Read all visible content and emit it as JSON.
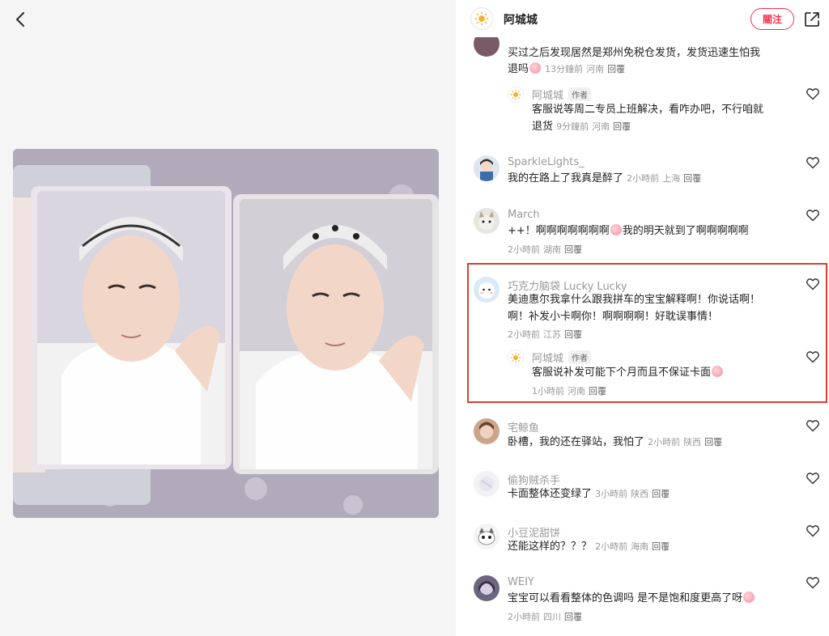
{
  "header": {
    "name": "阿城城",
    "follow_label": "關注"
  },
  "comments": [
    {
      "text_lines": [
        "买过之后发现居然是郑州免税仓发货，发货迅速生怕我",
        "退吗"
      ],
      "time": "13分鐘前",
      "location": "河南",
      "reply": "回覆",
      "reply_item": {
        "name": "阿城城",
        "tag": "作者",
        "text_lines": [
          "客服说等周二专员上班解决，看咋办吧，不行咱就",
          "退货"
        ],
        "time": "9分鐘前",
        "location": "河南",
        "reply": "回覆"
      }
    },
    {
      "name": "SparkleLights_",
      "text": "我的在路上了我真是醉了",
      "time": "2小時前",
      "location": "上海",
      "reply": "回覆"
    },
    {
      "name": "March",
      "text": "++！啊啊啊啊啊啊啊",
      "text_tail": "我的明天就到了啊啊啊啊啊",
      "time": "2小時前",
      "location": "湖南",
      "reply": "回覆"
    },
    {
      "name": "巧克力脑袋 Lucky Lucky",
      "text_lines": [
        "美迪惠尔我拿什么跟我拼车的宝宝解释啊！你说话啊！",
        "啊！补发小卡啊你！啊啊啊啊！好耽误事情！"
      ],
      "time": "2小時前",
      "location": "江苏",
      "reply": "回覆",
      "reply_item": {
        "name": "阿城城",
        "tag": "作者",
        "text": "客服说补发可能下个月而且不保证卡面",
        "time": "1小時前",
        "location": "河南",
        "reply": "回覆"
      }
    },
    {
      "name": "宅鲸鱼",
      "text": "卧槽，我的还在驿站，我怕了",
      "time": "2小時前",
      "location": "陕西",
      "reply": "回覆"
    },
    {
      "name": "偷狗贼杀手",
      "text": "卡面整体还变绿了",
      "time": "3小時前",
      "location": "陕西",
      "reply": "回覆"
    },
    {
      "name": "小豆泥甜饼",
      "text": "还能这样的？？？",
      "time": "2小時前",
      "location": "海南",
      "reply": "回覆"
    },
    {
      "name": "WEIY",
      "text": "宝宝可以看看整体的色调吗 是不是饱和度更高了呀",
      "time": "2小時前",
      "location": "四川",
      "reply": "回覆"
    }
  ],
  "colors": {
    "accent": "#ff2e4d",
    "highlight": "#d6402e",
    "meta": "#999999"
  }
}
